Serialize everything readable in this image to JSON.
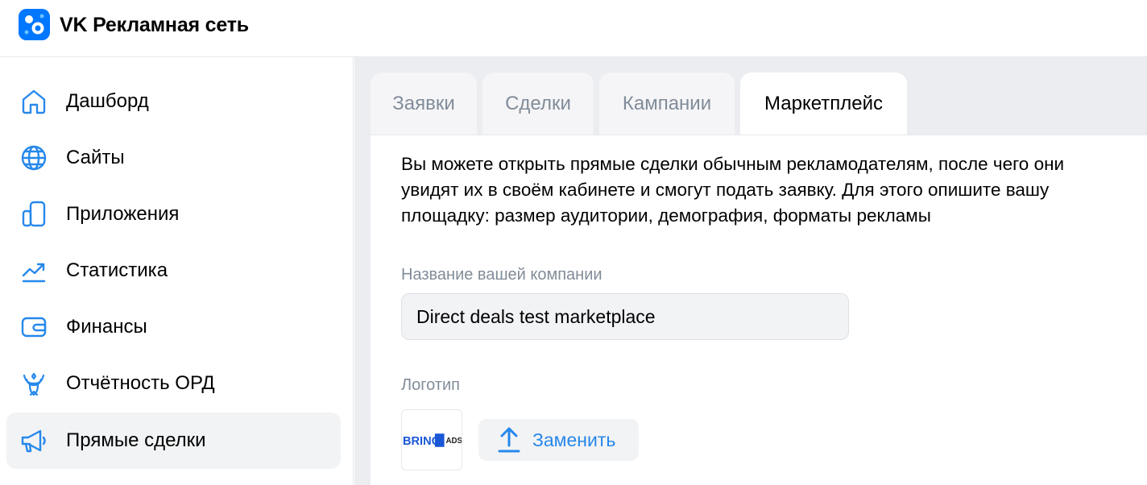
{
  "header": {
    "brand": "VK Рекламная сеть",
    "logo_icon": "vk-ads-logo-icon"
  },
  "colors": {
    "accent": "#2688eb",
    "logo_blue": "#0077ff",
    "muted_text": "#818c99",
    "active_bg": "#f2f3f5",
    "main_bg": "#ebedf0"
  },
  "sidebar": {
    "items": [
      {
        "label": "Дашборд",
        "icon": "home-icon",
        "active": false
      },
      {
        "label": "Сайты",
        "icon": "globe-icon",
        "active": false
      },
      {
        "label": "Приложения",
        "icon": "devices-icon",
        "active": false
      },
      {
        "label": "Статистика",
        "icon": "trending-up-icon",
        "active": false
      },
      {
        "label": "Финансы",
        "icon": "wallet-icon",
        "active": false
      },
      {
        "label": "Отчётность ОРД",
        "icon": "emblem-icon",
        "active": false
      },
      {
        "label": "Прямые сделки",
        "icon": "megaphone-icon",
        "active": true
      }
    ]
  },
  "tabs": [
    {
      "label": "Заявки",
      "active": false
    },
    {
      "label": "Сделки",
      "active": false
    },
    {
      "label": "Кампании",
      "active": false
    },
    {
      "label": "Маркетплейс",
      "active": true
    }
  ],
  "panel": {
    "description": "Вы можете открыть прямые сделки обычным рекламодателям, после чего они увидят их в своём кабинете и смогут подать заявку. Для этого опишите вашу площадку: размер аудитории, демография, форматы рекламы",
    "company_label": "Название вашей компании",
    "company_value": "Direct deals test marketplace",
    "logo_label": "Логотип",
    "logo_image": {
      "part1": "BRING",
      "part2": "ADS"
    },
    "replace_label": "Заменить",
    "replace_icon": "upload-icon"
  }
}
